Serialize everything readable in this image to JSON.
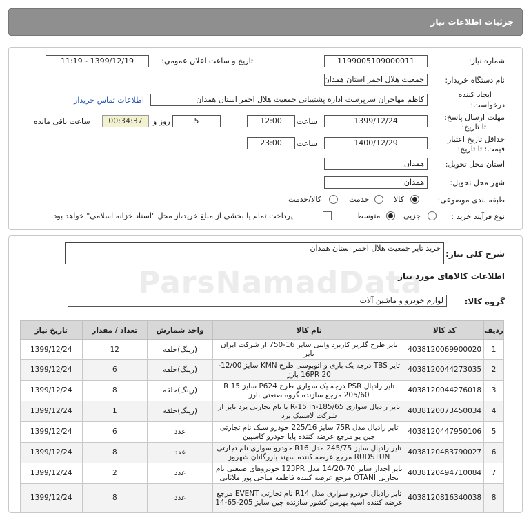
{
  "header": {
    "title": "جزئیات اطلاعات نیاز"
  },
  "form": {
    "need_number_label": "شماره نیاز:",
    "need_number": "1199005109000011",
    "announce_label": "تاریخ و ساعت اعلان عمومی:",
    "announce_value": "1399/12/19 - 11:19",
    "buyer_label": "نام دستگاه خریدار:",
    "buyer_value": "جمعیت هلال احمر استان همدان",
    "creator_label_1": "ایجاد کننده",
    "creator_label_2": "درخواست:",
    "creator_value": "کاظم مهاجران سرپرست اداره پشتیبانی جمعیت هلال احمر استان همدان",
    "contact_link": "اطلاعات تماس خریدار",
    "deadline_label_1": "مهلت ارسال پاسخ:",
    "deadline_label_2": "تا تاریخ:",
    "deadline_date": "1399/12/24",
    "time_word": "ساعت",
    "deadline_time": "12:00",
    "days_value": "5",
    "days_word": "روز و",
    "remaining_time": "00:34:37",
    "remaining_word": "ساعت باقی مانده",
    "validity_label_1": "حداقل تاریخ اعتبار",
    "validity_label_2": "قیمت: تا تاریخ:",
    "validity_date": "1400/12/29",
    "validity_time": "23:00",
    "province_label": "استان محل تحویل:",
    "province_value": "همدان",
    "city_label": "شهر محل تحویل:",
    "city_value": "همدان",
    "category_label": "طبقه بندی موضوعی:",
    "category_options": [
      "کالا",
      "خدمت",
      "کالا/خدمت"
    ],
    "category_selected": "کالا",
    "process_label": "نوع فرآیند خرید :",
    "process_options": [
      "جزیی",
      "متوسط"
    ],
    "process_selected": "متوسط",
    "payment_text": "پرداخت تمام یا بخشی از مبلغ خرید،از محل \"اسناد خزانه اسلامی\" خواهد بود."
  },
  "summary": {
    "label": "شرح کلی نیاز:",
    "value": "خرید تایر جمعیت هلال احمر استان همدان"
  },
  "goods_title": "اطلاعات کالاهای مورد نیاز",
  "group": {
    "label": "گروه کالا:",
    "value": "لوازم خودرو و ماشین آلات"
  },
  "watermark": "ParsNamadData",
  "table": {
    "headers": [
      "ردیف",
      "کد کالا",
      "نام کالا",
      "واحد شمارش",
      "تعداد / مقدار",
      "تاریخ نیاز"
    ],
    "rows": [
      [
        "1",
        "4038120069900020",
        "تایر طرح گلریز کاربرد وانتی سایز 16-750 از شرکت ایران تایر",
        "(رینگ)حلقه",
        "12",
        "1399/12/24"
      ],
      [
        "2",
        "4038120044273035",
        "تایر TBS درجه یک باری و اتوبوسی طرح KMN سایز 12/00-20 16PR بارز",
        "(رینگ)حلقه",
        "6",
        "1399/12/24"
      ],
      [
        "3",
        "4038120044276018",
        "تایر رادیال PSR درجه یک سواری طرح P624 سایز R 15 205/60 مرجع سازنده گروه صنعتی بارز",
        "(رینگ)حلقه",
        "8",
        "1399/12/24"
      ],
      [
        "4",
        "4038120073450034",
        "تایر رادیال سواری R-15 in-185/65 با نام تجارتی یزد تایر از شرکت لاستیک یزد",
        "(رینگ)حلقه",
        "1",
        "1399/12/24"
      ],
      [
        "5",
        "4038120447950106",
        "تایر رادیال مدل 75R سایز 225/16 خودرو سبک نام تجارتی جین یو مرجع عرضه کننده پایا خودرو کاسپین",
        "عدد",
        "6",
        "1399/12/24"
      ],
      [
        "6",
        "4038120483790027",
        "تایر رادیال سایز 245/75 مدل R16 خودرو سواری نام تجارتی RUDSTUN مرجع عرضه کننده سهند بازرگانان شهروز",
        "عدد",
        "8",
        "1399/12/24"
      ],
      [
        "7",
        "4038120494710084",
        "تایر آجدار سایز 70-14/20 مدل 123PR خودروهای صنعتی نام تجارتی OTANI مرجع عرضه کننده فاطمه میاحی پور ملاثانی",
        "عدد",
        "2",
        "1399/12/24"
      ],
      [
        "8",
        "4038120816340038",
        "تایر رادیال خودرو سواری مدل R14 نام تجارتی EVENT مرجع عرضه کننده اسپه بهرمن کشور سازنده چین سایز 205-65-14",
        "عدد",
        "8",
        "1399/12/24"
      ]
    ]
  }
}
